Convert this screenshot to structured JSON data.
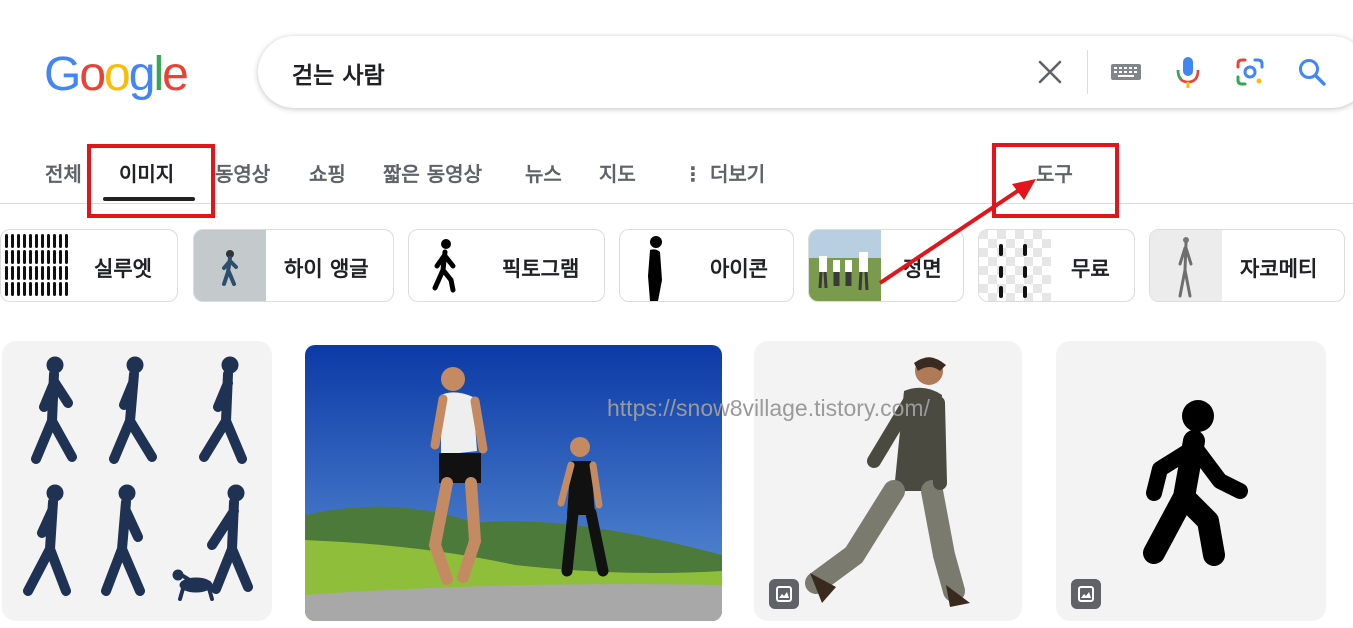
{
  "logo": {
    "letters": [
      "G",
      "o",
      "o",
      "g",
      "l",
      "e"
    ]
  },
  "search": {
    "query": "걷는 사람"
  },
  "search_icons": [
    "close-icon",
    "keyboard-icon",
    "microphone-icon",
    "google-lens-icon",
    "search-icon"
  ],
  "tabs": [
    {
      "label": "전체"
    },
    {
      "label": "이미지",
      "active": true
    },
    {
      "label": "동영상"
    },
    {
      "label": "쇼핑"
    },
    {
      "label": "짧은 동영상"
    },
    {
      "label": "뉴스"
    },
    {
      "label": "지도"
    },
    {
      "label": "⋮ 더보기"
    }
  ],
  "tools_label": "도구",
  "chips": [
    {
      "label": "실루엣"
    },
    {
      "label": "하이 앵글"
    },
    {
      "label": "픽토그램"
    },
    {
      "label": "아이콘"
    },
    {
      "label": "정면"
    },
    {
      "label": "무료"
    },
    {
      "label": "자코메티"
    }
  ],
  "watermark": "https://snow8village.tistory.com/",
  "colors": {
    "accent_red": "#e3141a",
    "silhouette_navy": "#1f3253",
    "google_blue": "#4285f4"
  }
}
